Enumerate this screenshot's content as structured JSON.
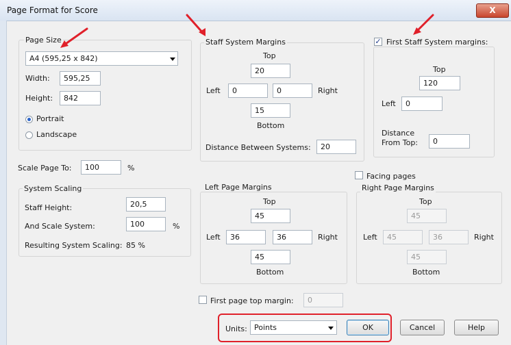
{
  "window": {
    "title": "Page Format for Score",
    "close_label": "X"
  },
  "page_size": {
    "group_label": "Page Size",
    "selected": "A4 (595,25 x 842)",
    "width_label": "Width:",
    "width_value": "595,25",
    "height_label": "Height:",
    "height_value": "842",
    "portrait_label": "Portrait",
    "landscape_label": "Landscape",
    "orientation": "Portrait"
  },
  "staff_margins": {
    "group_label": "Staff System Margins",
    "top_label": "Top",
    "top": "20",
    "left_label": "Left",
    "left": "0",
    "right": "0",
    "right_label": "Right",
    "bottom": "15",
    "bottom_label": "Bottom",
    "distance_label": "Distance Between Systems:",
    "distance": "20"
  },
  "first_staff": {
    "checkbox_label": "First Staff System margins:",
    "checked": true,
    "top_label": "Top",
    "top": "120",
    "left_label": "Left",
    "left": "0",
    "distance_label_1": "Distance",
    "distance_label_2": "From Top:",
    "distance": "0"
  },
  "scale_page": {
    "label": "Scale Page To:",
    "value": "100",
    "unit": "%"
  },
  "system_scaling": {
    "group_label": "System Scaling",
    "staff_height_label": "Staff Height:",
    "staff_height": "20,5",
    "and_scale_label": "And Scale System:",
    "and_scale": "100",
    "and_scale_unit": "%",
    "resulting_label": "Resulting System Scaling:",
    "resulting_value": "85 %"
  },
  "facing_pages": {
    "label": "Facing pages",
    "checked": false
  },
  "left_page": {
    "group_label": "Left Page Margins",
    "top_label": "Top",
    "top": "45",
    "left_label": "Left",
    "left": "36",
    "right": "36",
    "right_label": "Right",
    "bottom": "45",
    "bottom_label": "Bottom"
  },
  "right_page": {
    "group_label": "Right Page Margins",
    "top_label": "Top",
    "top": "45",
    "left_label": "Left",
    "left": "45",
    "right": "36",
    "right_label": "Right",
    "bottom": "45",
    "bottom_label": "Bottom"
  },
  "first_page_top": {
    "label": "First page top margin:",
    "value": "0",
    "checked": false
  },
  "footer": {
    "units_label": "Units:",
    "units_value": "Points",
    "ok_label": "OK",
    "cancel_label": "Cancel",
    "help_label": "Help"
  },
  "colors": {
    "annotation": "#e0202a",
    "title_gradient_top": "#eef3fa"
  }
}
